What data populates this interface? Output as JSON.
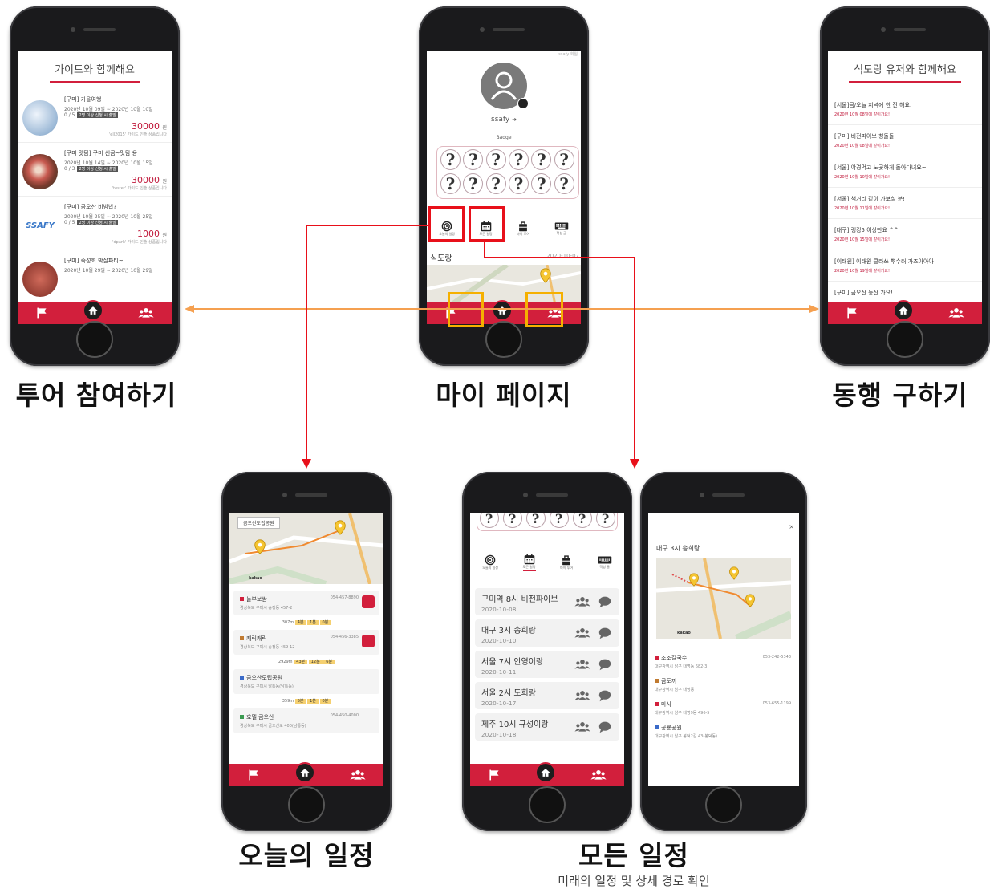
{
  "captions": {
    "tour": "투어 참여하기",
    "mypage": "마이 페이지",
    "companion": "동행 구하기",
    "today": "오늘의 일정",
    "all": "모든 일정",
    "all_sub": "미래의 일정 및 상세 경로 확인"
  },
  "colors": {
    "brand": "#d21f3c",
    "highlight_red": "#e8101a",
    "highlight_orange": "#f5b000",
    "arrow_orange": "#f5a050"
  },
  "tour_screen": {
    "title": "가이드와 함께해요",
    "items": [
      {
        "title": "[구미] 가을여행",
        "dates": "2020년 10월 09일 ~ 2020년 10월 10일",
        "count": "0 / 5",
        "badge": "2명 이상 신청 시 출발",
        "price": "30000",
        "unit": "원",
        "by": "'ell2015' 가이드 인솔 상품입니다"
      },
      {
        "title": "[구미 맛탐] 구미 선금~맛탐 용",
        "dates": "2020년 10월 14일 ~ 2020년 10월 15일",
        "count": "0 / 3",
        "badge": "2명 이상 신청 시 출발",
        "price": "30000",
        "unit": "원",
        "by": "'tester' 가이드 인솔 상품입니다"
      },
      {
        "title": "[구미] 금오산 비빔밥?",
        "dates": "2020년 10월 25일 ~ 2020년 10월 25일",
        "count": "0 / 5",
        "badge": "2명 이상 신청 시 출발",
        "price": "1000",
        "unit": "원",
        "by": "'dpark' 가이드 인솔 상품입니다"
      },
      {
        "title": "[구미] 숙성회 박살파티~",
        "dates": "2020년 10월 29일 ~ 2020년 10월 29일",
        "count": "",
        "badge": "",
        "price": "",
        "unit": "",
        "by": ""
      }
    ],
    "thumb_text": "SSAFY"
  },
  "mypage_screen": {
    "top_text": "ssafy 회원",
    "username": "ssafy",
    "badge_label": "Badge",
    "badge_glyph": "?",
    "tabs": [
      "오늘의 일정",
      "모든 일정",
      "마이 투어",
      "작성 글"
    ],
    "section_title": "식도랑",
    "section_date": "2020-10-07"
  },
  "companion_screen": {
    "title": "식도랑 유저와 함께해요",
    "posts": [
      {
        "title": "[서울]금/오늘 저녁에 한 잔 해요.",
        "date": "2020년 10월 08일에 같이가요!"
      },
      {
        "title": "[구미] 비전파이브 청돌돌",
        "date": "2020년 10월 08일에 같이가요!"
      },
      {
        "title": "[서울] 야경먹고 노곳하게 돌아다녀요~",
        "date": "2020년 10월 10일에 같이가요!"
      },
      {
        "title": "[서울] 책거리 같이 가보실 분!",
        "date": "2020년 10월 11일에 같이가요!"
      },
      {
        "title": "[대구] 랭킹5 이상만요 ^^",
        "date": "2020년 10월 15일에 같이가요!"
      },
      {
        "title": "[이태원] 이태원 클라쓰 뿌수러 가즈아아아",
        "date": "2020년 10월 19일에 같이가요!"
      },
      {
        "title": "[구미] 금오산 등산 가요!",
        "date": ""
      }
    ]
  },
  "today_screen": {
    "map_label": "금오산도립공원",
    "map_brand": "kakao",
    "stops": [
      {
        "name": "늘부보쌈",
        "addr": "경상북도 구미시 송정동 457-2",
        "tel": "054-457-8890"
      },
      {
        "name": "캐릭캐릭",
        "addr": "경상북도 구미시 송정동 459-12",
        "tel": "054-456-3385"
      },
      {
        "name": "금오산도립공원",
        "addr": "경상북도 구미시 남통동(남통동)",
        "tel": ""
      },
      {
        "name": "호텔 금오산",
        "addr": "경상북도 구미시 금오산로 400(남통동)",
        "tel": "054-450-4000"
      }
    ],
    "routes": [
      {
        "dist": "307m",
        "walk": "4분",
        "bike": "1분",
        "car": "0분"
      },
      {
        "dist": "2929m",
        "walk": "43분",
        "bike": "12분",
        "car": "6분"
      },
      {
        "dist": "359m",
        "walk": "5분",
        "bike": "1분",
        "car": "0분"
      }
    ]
  },
  "all_screen": {
    "tabs": [
      "오늘의 일정",
      "모든 일정",
      "마이 투어",
      "작성 글"
    ],
    "schedules": [
      {
        "title": "구미역 8시 비전파이브",
        "date": "2020-10-08"
      },
      {
        "title": "대구 3시 송희랑",
        "date": "2020-10-10"
      },
      {
        "title": "서울 7시 안영이랑",
        "date": "2020-10-11"
      },
      {
        "title": "서울 2시 도희랑",
        "date": "2020-10-17"
      },
      {
        "title": "제주 10시 규성이랑",
        "date": "2020-10-18"
      }
    ]
  },
  "detail_screen": {
    "title": "대구 3시 송희랑",
    "map_brand": "kakao",
    "stops": [
      {
        "name": "조조칼국수",
        "addr": "대구광역시 남구 대명동 682-3",
        "tel": "053-242-5343"
      },
      {
        "name": "금토끼",
        "addr": "대구광역시 남구 대명동",
        "tel": ""
      },
      {
        "name": "마사",
        "addr": "대구광역시 남구 대명9동 496-5",
        "tel": "053-655-1199"
      },
      {
        "name": "공룡공원",
        "addr": "대구광역시 남구 봉덕2길 43(봉덕동)",
        "tel": ""
      }
    ]
  }
}
